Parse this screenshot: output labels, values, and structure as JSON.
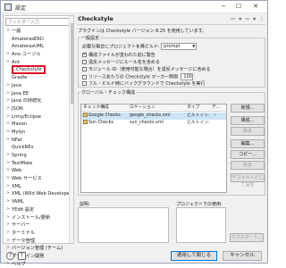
{
  "window": {
    "title": "設定",
    "min": "−",
    "max": "☐",
    "close": "✕"
  },
  "left": {
    "filter_placeholder": "フィルター入力",
    "tree": [
      {
        "label": "一般",
        "arrow": ">",
        "child": false
      },
      {
        "label": "AmaterasERD",
        "arrow": "",
        "child": false
      },
      {
        "label": "AmaterasUML",
        "arrow": "",
        "child": false
      },
      {
        "label": "Ano ユーゾル",
        "arrow": ">",
        "child": false
      },
      {
        "label": "Ant",
        "arrow": ">",
        "child": false
      },
      {
        "label": "Checkstyle",
        "arrow": "",
        "child": false,
        "selected": true
      },
      {
        "label": "Gradle",
        "arrow": "",
        "child": false
      },
      {
        "label": "Java",
        "arrow": ">",
        "child": false
      },
      {
        "label": "Java EE",
        "arrow": ">",
        "child": false
      },
      {
        "label": "Java の持続化",
        "arrow": ">",
        "child": false
      },
      {
        "label": "JSON",
        "arrow": ">",
        "child": false
      },
      {
        "label": "Lrmy/Eclipse",
        "arrow": ">",
        "child": false
      },
      {
        "label": "Maven",
        "arrow": ">",
        "child": false
      },
      {
        "label": "Mylyn",
        "arrow": ">",
        "child": false
      },
      {
        "label": "NFat",
        "arrow": ">",
        "child": false
      },
      {
        "label": "QuickREx",
        "arrow": "",
        "child": false
      },
      {
        "label": "Spring",
        "arrow": ">",
        "child": false
      },
      {
        "label": "TextMate",
        "arrow": ">",
        "child": false
      },
      {
        "label": "Web",
        "arrow": ">",
        "child": false
      },
      {
        "label": "Web サービス",
        "arrow": ">",
        "child": false
      },
      {
        "label": "XML",
        "arrow": ">",
        "child": false
      },
      {
        "label": "XML (Wild Web Developer)",
        "arrow": ">",
        "child": false
      },
      {
        "label": "YAML",
        "arrow": ">",
        "child": false
      },
      {
        "label": "YEdit 設定",
        "arrow": ">",
        "child": false
      },
      {
        "label": "インストール/更新",
        "arrow": ">",
        "child": false
      },
      {
        "label": "サーバー",
        "arrow": ">",
        "child": false
      },
      {
        "label": "ターミナル",
        "arrow": ">",
        "child": false
      },
      {
        "label": "データ管理",
        "arrow": ">",
        "child": false
      },
      {
        "label": "バージョン管理 (チーム)",
        "arrow": ">",
        "child": false
      },
      {
        "label": "プラグイン開発",
        "arrow": ">",
        "child": false
      },
      {
        "label": "ヘルプ",
        "arrow": ">",
        "child": false
      }
    ]
  },
  "right": {
    "title": "Checkstyle",
    "nav": "⇦ ▾ ⇨ ▾ ⋮",
    "desc": "プラグインは Checkstyle バージョン 8.25 を使用しています。",
    "general_label": "一般設定",
    "rebuild_label": "必要な場合にプロジェクトを再ビルド:",
    "rebuild_value": "prompt",
    "options": [
      {
        "label": "構成ファイルが変われた前に警告",
        "checked": true
      },
      {
        "label": "違反メッセージにルール名を含める",
        "checked": false
      },
      {
        "label": "モジュール ID（使用可能な場合）を違反メッセージに含める",
        "checked": false
      },
      {
        "label": "リソースあたりの Checkstyle マーカー制限",
        "checked": false,
        "limit": "100"
      },
      {
        "label": "フル・ビルド時にバックグラウンドで Checkstyle を実行",
        "checked": false
      }
    ],
    "global_label": "グローバル・チェック構成",
    "table": {
      "headers": [
        "チェック構成",
        "ロケーション",
        "タイプ",
        "デ..."
      ],
      "rows": [
        {
          "name": "Google Checks",
          "location": "google_checks.xml",
          "type": "ビルトイン...",
          "default": "✓",
          "selected": true
        },
        {
          "name": "Sun Checks",
          "location": "sun_checks.xml",
          "type": "ビルトイン...",
          "default": "",
          "selected": false
        }
      ]
    },
    "buttons": [
      {
        "label": "新規...",
        "disabled": false
      },
      {
        "label": "構成...",
        "disabled": false
      },
      {
        "label": "除去",
        "disabled": true
      },
      {
        "label": "編集...",
        "disabled": false
      },
      {
        "label": "コピー...",
        "disabled": false
      },
      {
        "label": "除去",
        "disabled": true
      },
      {
        "label": "デフォルトとして設定",
        "disabled": true
      }
    ],
    "desc_label": "説明:",
    "project_label": "プロジェクトでの使用:",
    "export_label": "エクスポート..."
  },
  "footer": {
    "help1": "?",
    "help2": "⤒",
    "apply_close": "適用して閉じる",
    "cancel": "キャンセル"
  }
}
